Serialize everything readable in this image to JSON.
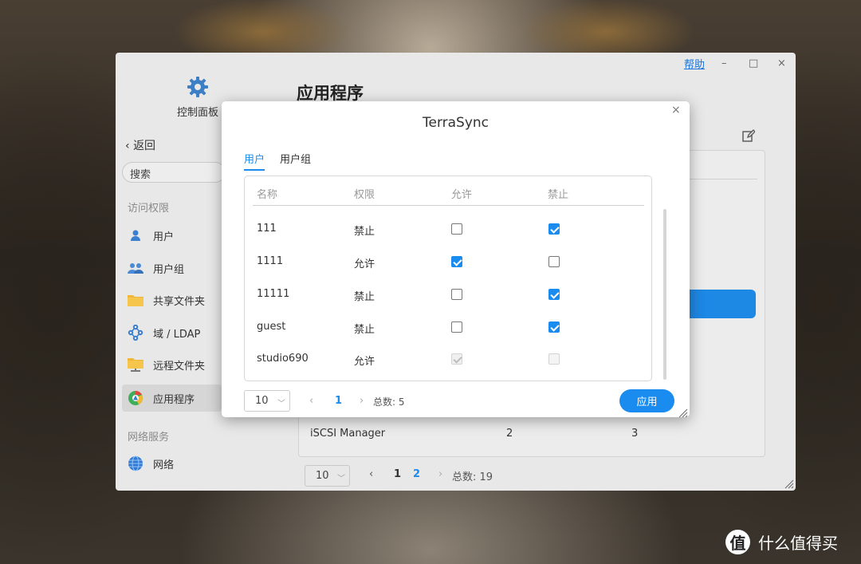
{
  "window": {
    "help": "帮助",
    "controls": {
      "minimize": "–",
      "maximize": "□",
      "close": "×"
    },
    "control_panel_label": "控制面板",
    "back_label": "返回",
    "search_placeholder": "搜索",
    "page_title": "应用程序",
    "sections": {
      "access": "访问权限",
      "network": "网络服务"
    },
    "nav": [
      {
        "label": "用户",
        "icon": "user-icon"
      },
      {
        "label": "用户组",
        "icon": "group-icon"
      },
      {
        "label": "共享文件夹",
        "icon": "folder-icon"
      },
      {
        "label": "域 / LDAP",
        "icon": "ldap-icon"
      },
      {
        "label": "远程文件夹",
        "icon": "remote-folder-icon"
      },
      {
        "label": "应用程序",
        "icon": "app-icon",
        "active": true
      },
      {
        "label": "网络",
        "icon": "network-icon"
      }
    ],
    "bg_row": {
      "name": "iSCSI Manager",
      "c1": "2",
      "c2": "3"
    },
    "pager": {
      "page_size": "10",
      "pages": [
        "1",
        "2"
      ],
      "current": "2",
      "total": "总数: 19"
    }
  },
  "modal": {
    "title": "TerraSync",
    "close": "×",
    "tabs": [
      "用户",
      "用户组"
    ],
    "active_tab": "用户",
    "columns": [
      "名称",
      "权限",
      "允许",
      "禁止"
    ],
    "rows": [
      {
        "name": "111",
        "perm": "禁止",
        "allow": false,
        "deny": true,
        "disabled": false
      },
      {
        "name": "1111",
        "perm": "允许",
        "allow": true,
        "deny": false,
        "disabled": false
      },
      {
        "name": "11111",
        "perm": "禁止",
        "allow": false,
        "deny": true,
        "disabled": false
      },
      {
        "name": "guest",
        "perm": "禁止",
        "allow": false,
        "deny": true,
        "disabled": false
      },
      {
        "name": "studio690",
        "perm": "允许",
        "allow": true,
        "deny": false,
        "disabled": true
      }
    ],
    "pager": {
      "page_size": "10",
      "page": "1",
      "total": "总数: 5"
    },
    "apply": "应用"
  },
  "watermark": {
    "logo": "值",
    "text": "什么值得买"
  },
  "colors": {
    "accent": "#1a8cf0"
  }
}
